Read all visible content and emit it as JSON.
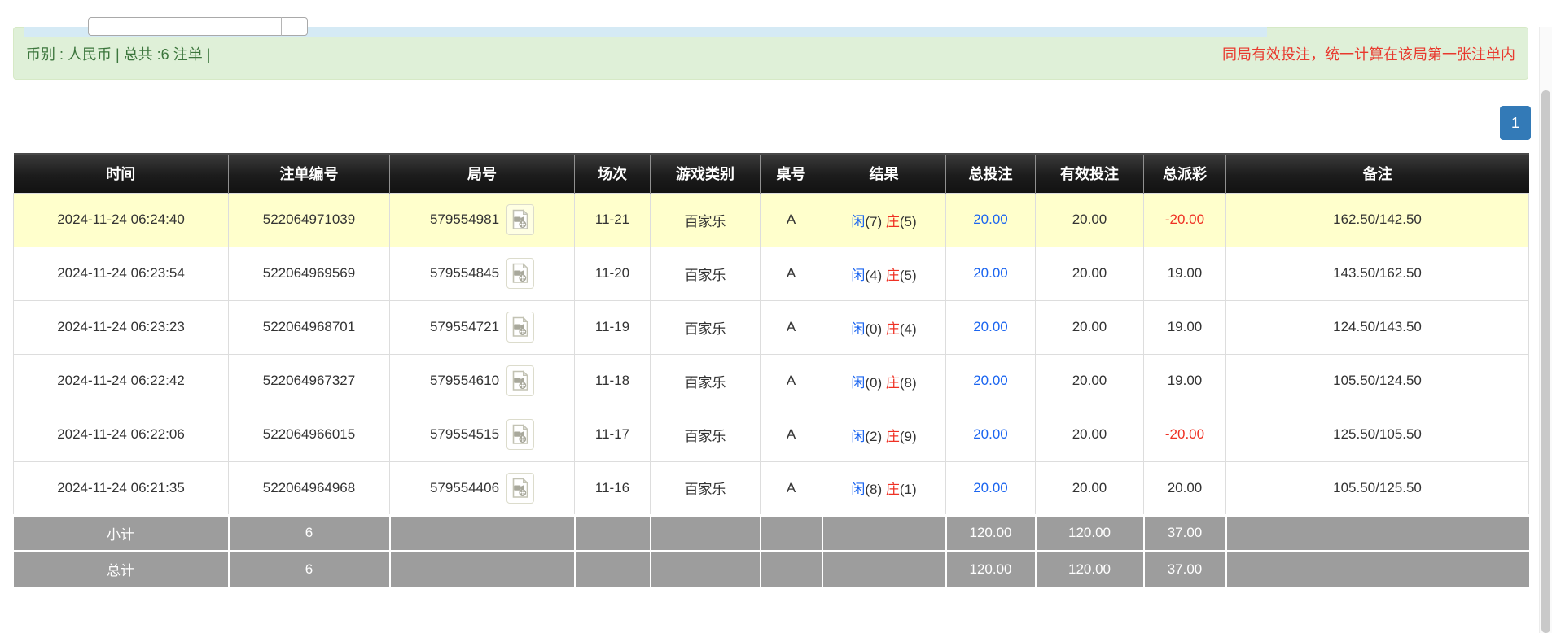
{
  "colors": {
    "accent_blue": "#337ab7",
    "link_blue": "#1b65f0",
    "danger_red": "#ef3124",
    "notice_red": "#e8392e",
    "success_green_bg": "#dff0d8",
    "success_green_text": "#3c763d",
    "highlight_yellow": "#ffffcc",
    "totals_gray": "#9d9d9d",
    "panel_blue": "#d5eaf5",
    "header_black": "#1c1c1c"
  },
  "top_form": {
    "input_value": ""
  },
  "alert": {
    "summary": "币别 : 人民币 | 总共 :6 注单 |",
    "notice": "同局有效投注，统一计算在该局第一张注单内"
  },
  "pagination": {
    "current_page": "1"
  },
  "table": {
    "headers": [
      "时间",
      "注单编号",
      "局号",
      "场次",
      "游戏类别",
      "桌号",
      "结果",
      "总投注",
      "有效投注",
      "总派彩",
      "备注"
    ],
    "video_icon": "video-icon",
    "rows": [
      {
        "time": "2024-11-24 06:24:40",
        "bet_id": "522064971039",
        "round_id": "579554981",
        "session": "11-21",
        "game": "百家乐",
        "table_no": "A",
        "player": "闲",
        "player_score": "(7)",
        "banker": "庄",
        "banker_score": "(5)",
        "total_bet": "20.00",
        "valid_bet": "20.00",
        "payout": "-20.00",
        "remark": "162.50/142.50",
        "highlighted": true
      },
      {
        "time": "2024-11-24 06:23:54",
        "bet_id": "522064969569",
        "round_id": "579554845",
        "session": "11-20",
        "game": "百家乐",
        "table_no": "A",
        "player": "闲",
        "player_score": "(4)",
        "banker": "庄",
        "banker_score": "(5)",
        "total_bet": "20.00",
        "valid_bet": "20.00",
        "payout": "19.00",
        "remark": "143.50/162.50",
        "highlighted": false
      },
      {
        "time": "2024-11-24 06:23:23",
        "bet_id": "522064968701",
        "round_id": "579554721",
        "session": "11-19",
        "game": "百家乐",
        "table_no": "A",
        "player": "闲",
        "player_score": "(0)",
        "banker": "庄",
        "banker_score": "(4)",
        "total_bet": "20.00",
        "valid_bet": "20.00",
        "payout": "19.00",
        "remark": "124.50/143.50",
        "highlighted": false
      },
      {
        "time": "2024-11-24 06:22:42",
        "bet_id": "522064967327",
        "round_id": "579554610",
        "session": "11-18",
        "game": "百家乐",
        "table_no": "A",
        "player": "闲",
        "player_score": "(0)",
        "banker": "庄",
        "banker_score": "(8)",
        "total_bet": "20.00",
        "valid_bet": "20.00",
        "payout": "19.00",
        "remark": "105.50/124.50",
        "highlighted": false
      },
      {
        "time": "2024-11-24 06:22:06",
        "bet_id": "522064966015",
        "round_id": "579554515",
        "session": "11-17",
        "game": "百家乐",
        "table_no": "A",
        "player": "闲",
        "player_score": "(2)",
        "banker": "庄",
        "banker_score": "(9)",
        "total_bet": "20.00",
        "valid_bet": "20.00",
        "payout": "-20.00",
        "remark": "125.50/105.50",
        "highlighted": false
      },
      {
        "time": "2024-11-24 06:21:35",
        "bet_id": "522064964968",
        "round_id": "579554406",
        "session": "11-16",
        "game": "百家乐",
        "table_no": "A",
        "player": "闲",
        "player_score": "(8)",
        "banker": "庄",
        "banker_score": "(1)",
        "total_bet": "20.00",
        "valid_bet": "20.00",
        "payout": "20.00",
        "remark": "105.50/125.50",
        "highlighted": false
      }
    ],
    "totals": [
      {
        "label": "小计",
        "count": "6",
        "total_bet": "120.00",
        "valid_bet": "120.00",
        "payout": "37.00"
      },
      {
        "label": "总计",
        "count": "6",
        "total_bet": "120.00",
        "valid_bet": "120.00",
        "payout": "37.00"
      }
    ]
  }
}
